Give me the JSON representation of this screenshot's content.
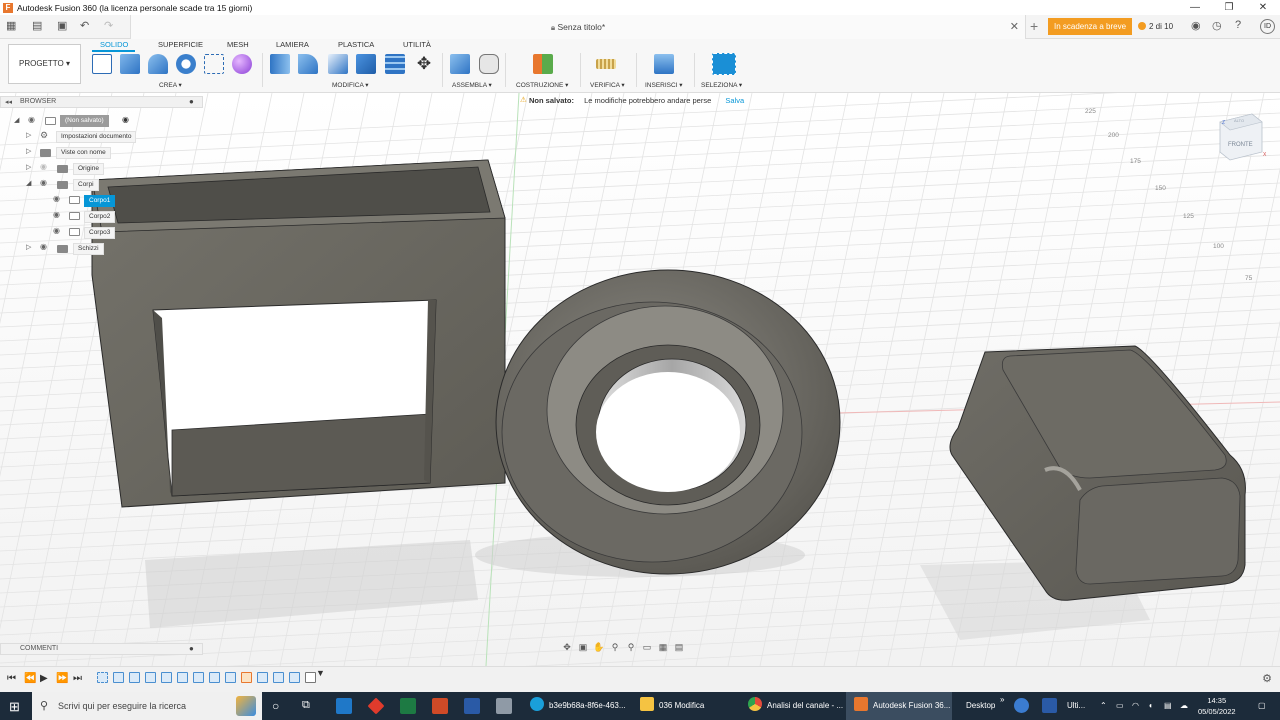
{
  "window": {
    "title": "Autodesk Fusion 360 (la licenza personale scade tra 15 giorni)",
    "minimize_icon": "minimize-icon",
    "maximize_icon": "restore-icon",
    "close_icon": "close-icon"
  },
  "tabbar": {
    "document_tab": "Senza titolo*",
    "expiry_button": "In scadenza a breve",
    "jobs_label": "2 di 10",
    "avatar_initials": "ID"
  },
  "toolbar": {
    "project_button": "PROGETTO ▾",
    "workspace_tabs": [
      "SOLIDO",
      "SUPERFICIE",
      "MESH",
      "LAMIERA",
      "PLASTICA",
      "UTILITÀ"
    ],
    "active_tab": "SOLIDO",
    "groups": [
      "CREA ▾",
      "MODIFICA ▾",
      "ASSEMBLA ▾",
      "COSTRUZIONE ▾",
      "VERIFICA ▾",
      "INSERISCI ▾",
      "SELEZIONA ▾"
    ]
  },
  "browser": {
    "title": "BROWSER",
    "items": [
      {
        "label": "(Non salvato)"
      },
      {
        "label": "Impostazioni documento"
      },
      {
        "label": "Viste con nome"
      },
      {
        "label": "Origine"
      },
      {
        "label": "Corpi"
      },
      {
        "label": "Corpo1",
        "selected": true
      },
      {
        "label": "Corpo2"
      },
      {
        "label": "Corpo3"
      },
      {
        "label": "Schizzi"
      }
    ]
  },
  "notice": {
    "title": "Non salvato:",
    "message": "Le modifiche potrebbero andare perse",
    "action": "Salva"
  },
  "viewcube": {
    "face_label": "FRONTE",
    "top_label": "ALTO",
    "axis_x": "X",
    "axis_z": "Z"
  },
  "ruler_labels": [
    "225",
    "200",
    "175",
    "150",
    "125",
    "100",
    "75"
  ],
  "comments": {
    "title": "COMMENTI"
  },
  "taskbar": {
    "search_placeholder": "Scrivi qui per eseguire la ricerca",
    "apps": [
      {
        "label": "b3e9b68a-8f6e-463...",
        "color": "#1a9fda"
      },
      {
        "label": "036 Modifica",
        "color": "#f5c342"
      },
      {
        "label": "Analisi del canale - ...",
        "color": "#e44b3b"
      },
      {
        "label": "Autodesk Fusion 36...",
        "color": "#e8772e"
      }
    ],
    "desktop_label": "Desktop",
    "tray_label": "Ulti...",
    "time": "14:35",
    "date": "05/05/2022"
  },
  "colors": {
    "accent": "#0696d7",
    "warning": "#f39c21",
    "model_body": "#6b6961"
  }
}
